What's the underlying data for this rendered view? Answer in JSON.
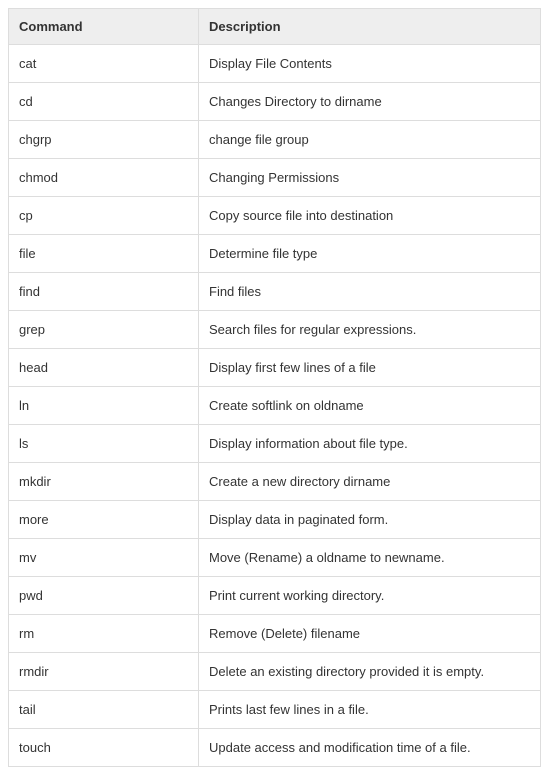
{
  "headers": {
    "command": "Command",
    "description": "Description"
  },
  "rows": [
    {
      "command": "cat",
      "description": "Display File Contents"
    },
    {
      "command": "cd",
      "description": "Changes Directory to dirname"
    },
    {
      "command": "chgrp",
      "description": "change file group"
    },
    {
      "command": "chmod",
      "description": "Changing Permissions"
    },
    {
      "command": "cp",
      "description": "Copy source file into destination"
    },
    {
      "command": "file",
      "description": "Determine file type"
    },
    {
      "command": "find",
      "description": "Find files"
    },
    {
      "command": "grep",
      "description": "Search files for regular expressions."
    },
    {
      "command": "head",
      "description": "Display first few lines of a file"
    },
    {
      "command": "ln",
      "description": "Create softlink on oldname"
    },
    {
      "command": "ls",
      "description": "Display information about file type."
    },
    {
      "command": "mkdir",
      "description": "Create a new directory dirname"
    },
    {
      "command": "more",
      "description": "Display data in paginated form."
    },
    {
      "command": "mv",
      "description": "Move (Rename) a oldname to newname."
    },
    {
      "command": "pwd",
      "description": "Print current working directory."
    },
    {
      "command": "rm",
      "description": "Remove (Delete) filename"
    },
    {
      "command": "rmdir",
      "description": "Delete an existing directory provided it is empty."
    },
    {
      "command": "tail",
      "description": "Prints last few lines in a file."
    },
    {
      "command": "touch",
      "description": "Update access and modification time of a file."
    }
  ]
}
